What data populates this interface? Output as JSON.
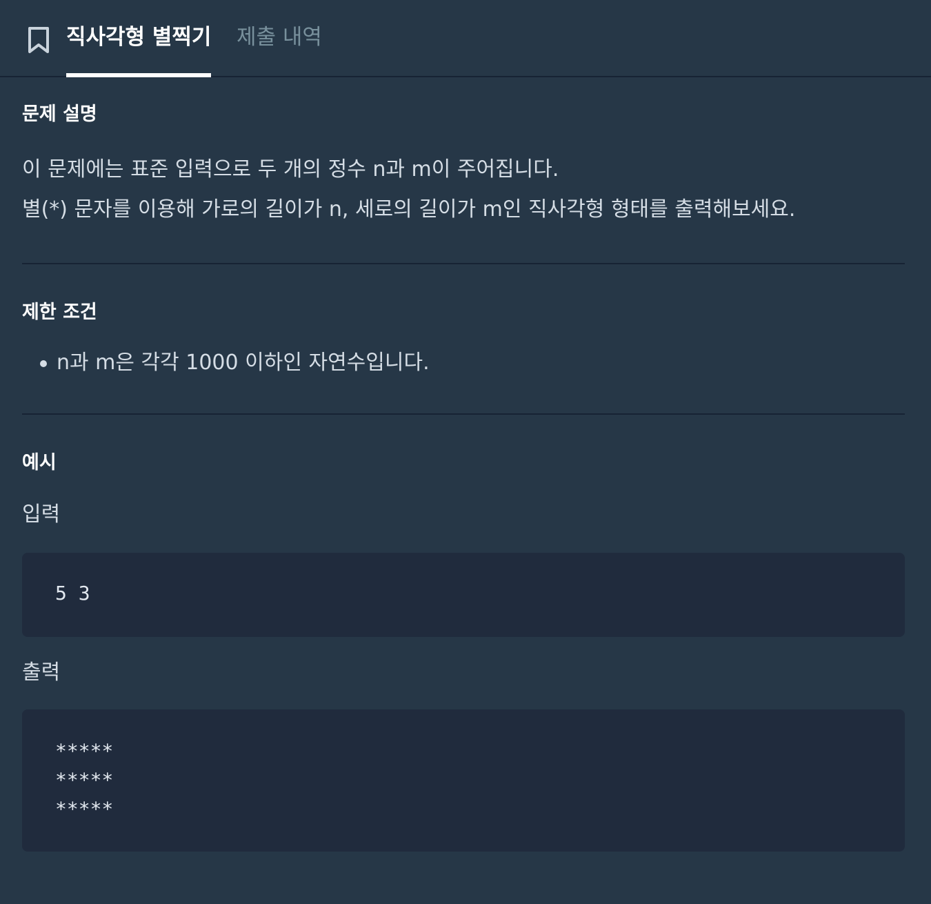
{
  "tabs": {
    "active_label": "직사각형 별찍기",
    "inactive_label": "제출 내역"
  },
  "description": {
    "title": "문제 설명",
    "lines": [
      "이 문제에는 표준 입력으로 두 개의 정수 n과 m이 주어집니다.",
      "별(*) 문자를 이용해 가로의 길이가 n, 세로의 길이가 m인 직사각형 형태를 출력해보세요."
    ]
  },
  "constraints": {
    "title": "제한 조건",
    "items": [
      "n과 m은 각각 1000 이하인 자연수입니다."
    ]
  },
  "example": {
    "title": "예시",
    "input_label": "입력",
    "input_lines": [
      "5 3"
    ],
    "output_label": "출력",
    "output_lines": [
      "*****",
      "*****",
      "*****"
    ]
  },
  "colors": {
    "background": "#263747",
    "code_background": "#202b3d",
    "divider": "#172334",
    "inactive_tab": "#78909c"
  }
}
